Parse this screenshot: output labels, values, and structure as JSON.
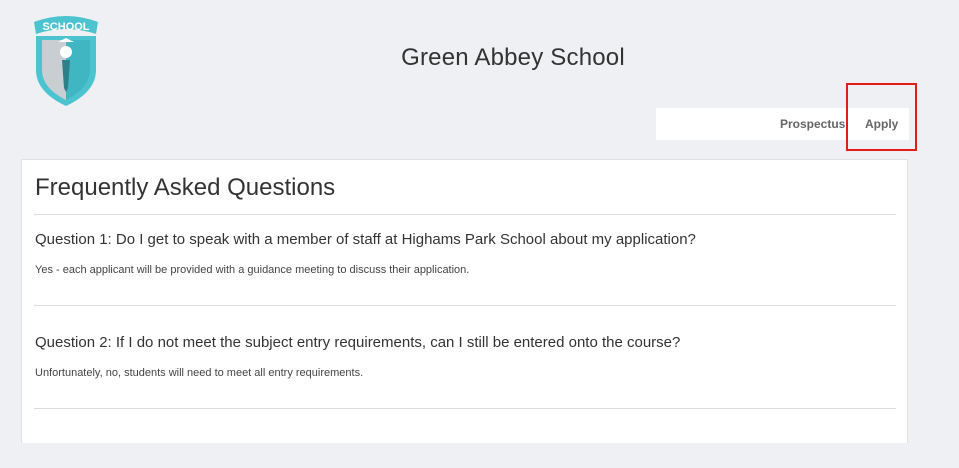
{
  "header": {
    "logo_text": "SCHOOL",
    "school_name": "Green Abbey School"
  },
  "nav": {
    "items": [
      {
        "label": "Prospectus"
      },
      {
        "label": "Apply"
      }
    ]
  },
  "faq": {
    "heading": "Frequently Asked Questions",
    "items": [
      {
        "question": "Question 1: Do I get to speak with a member of staff at Highams Park School about my application?",
        "answer": "Yes - each applicant will be provided with a guidance meeting to discuss their application."
      },
      {
        "question": "Question 2: If I do not meet the subject entry requirements, can I still be entered onto the course?",
        "answer": "Unfortunately, no, students will need to meet all entry requirements."
      }
    ]
  },
  "colors": {
    "accent": "#4cc4cf",
    "highlight": "#e31b1b",
    "background": "#eef0f4"
  }
}
